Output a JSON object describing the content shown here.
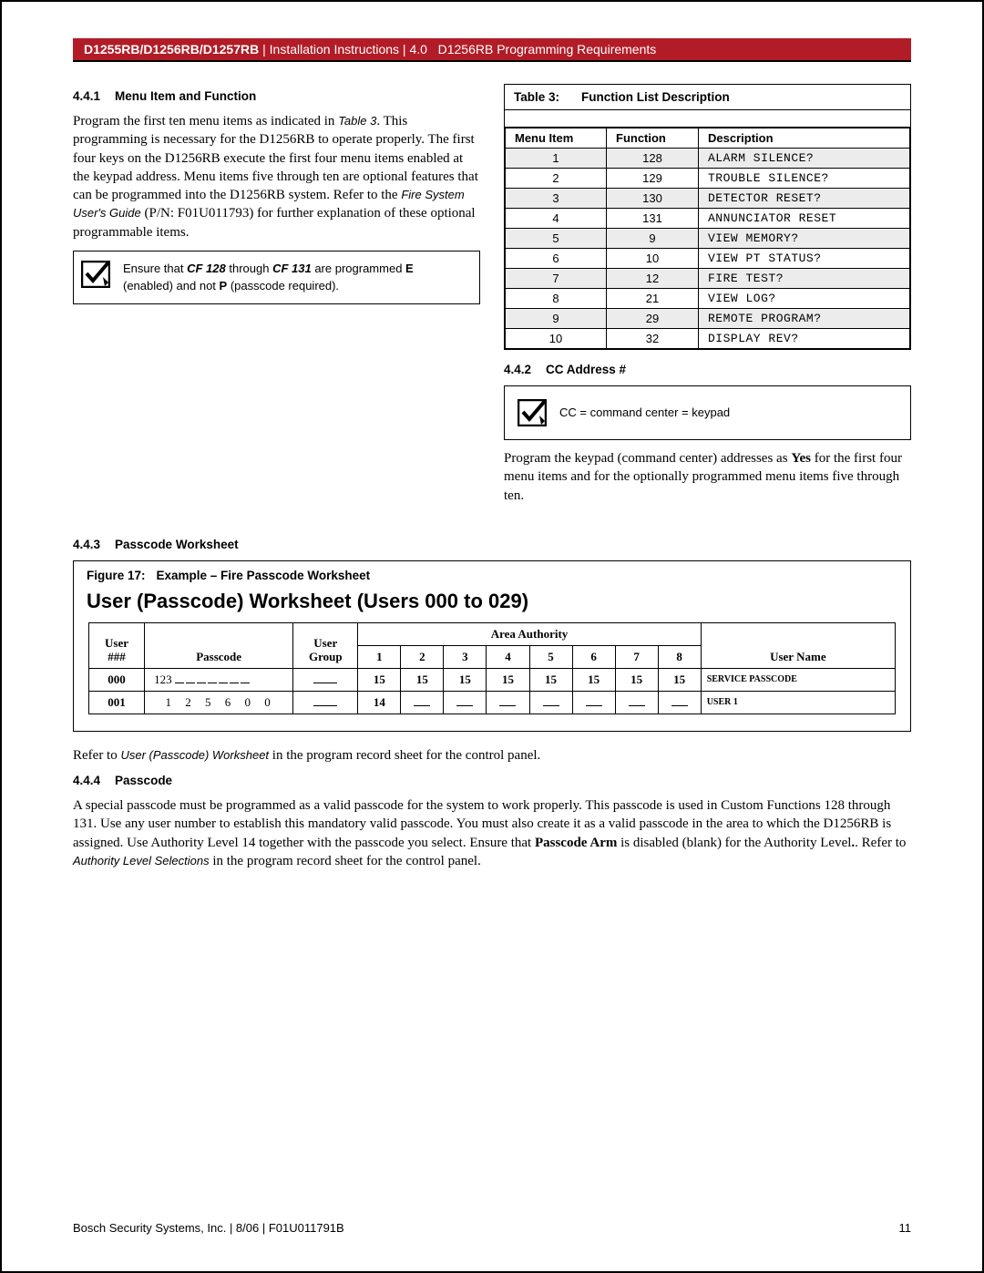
{
  "header": {
    "models": "D1255RB/D1256RB/D1257RB",
    "sep1": " | ",
    "doc_type": "Installation Instructions",
    "sep2": " | ",
    "sec_num": "4.0",
    "sec_title": "D1256RB Programming Requirements"
  },
  "s441": {
    "num": "4.4.1",
    "title": "Menu Item and Function",
    "p_a": "Program the first ten menu items as indicated in ",
    "p_table_ref": "Table 3",
    "p_b": ". This programming is necessary for the D1256RB to operate properly. The first four keys on the D1256RB execute the first four menu items enabled at the keypad address. Menu items five through ten are optional features that can be programmed into the D1256RB system. Refer to the ",
    "p_guide": "Fire System User's Guide",
    "p_c": " (P/N: F01U011793) for further explanation of these optional programmable items.",
    "note_a": "Ensure that ",
    "note_cf128": "CF 128",
    "note_mid": " through ",
    "note_cf131": "CF 131",
    "note_b": " are programmed ",
    "note_e": "E",
    "note_c": " (enabled) and not ",
    "note_p": "P",
    "note_d": " (passcode required)."
  },
  "table3": {
    "label": "Table 3:",
    "title": "Function List Description",
    "h1": "Menu Item",
    "h2": "Function",
    "h3": "Description",
    "rows": [
      {
        "m": "1",
        "f": "128",
        "d": "ALARM SILENCE?"
      },
      {
        "m": "2",
        "f": "129",
        "d": "TROUBLE SILENCE?"
      },
      {
        "m": "3",
        "f": "130",
        "d": "DETECTOR RESET?"
      },
      {
        "m": "4",
        "f": "131",
        "d": "ANNUNCIATOR RESET"
      },
      {
        "m": "5",
        "f": "9",
        "d": "VIEW MEMORY?"
      },
      {
        "m": "6",
        "f": "10",
        "d": "VIEW PT STATUS?"
      },
      {
        "m": "7",
        "f": "12",
        "d": "FIRE TEST?"
      },
      {
        "m": "8",
        "f": "21",
        "d": "VIEW LOG?"
      },
      {
        "m": "9",
        "f": "29",
        "d": "REMOTE PROGRAM?"
      },
      {
        "m": "10",
        "f": "32",
        "d": "DISPLAY REV?"
      }
    ]
  },
  "s442": {
    "num": "4.4.2",
    "title": "CC Address #",
    "note": "CC = command center = keypad",
    "p": "Program the keypad (command center) addresses as ",
    "p_b": "Yes",
    "p2": " for the first four menu items and for the optionally programmed menu items five through ten."
  },
  "s443": {
    "num": "4.4.3",
    "title": "Passcode Worksheet",
    "fig_label": "Figure 17:",
    "fig_title": "Example – Fire Passcode Worksheet",
    "ws_title": "User (Passcode) Worksheet (Users 000 to 029)",
    "h_user": "User ###",
    "h_passcode": "Passcode",
    "h_group": "User Group",
    "h_area": "Area Authority",
    "h_un": "User Name",
    "areas": [
      "1",
      "2",
      "3",
      "4",
      "5",
      "6",
      "7",
      "8"
    ],
    "rows": [
      {
        "u": "000",
        "pc": "123",
        "pc_dashes": 7,
        "g": "",
        "a": [
          "15",
          "15",
          "15",
          "15",
          "15",
          "15",
          "15",
          "15"
        ],
        "un": "SERVICE PASSCODE"
      },
      {
        "u": "001",
        "pc": "1 2 5 6 0 0",
        "pc_dashes": 0,
        "g": "",
        "a": [
          "14",
          "",
          "",
          "",
          "",
          "",
          "",
          ""
        ],
        "un": "USER 1"
      }
    ],
    "after_a": "Refer to ",
    "after_it": "User (Passcode) Worksheet",
    "after_b": " in the program record sheet for the control panel."
  },
  "s444": {
    "num": "4.4.4",
    "title": "Passcode",
    "p_a": "A special passcode must be programmed as a valid passcode for the system to work properly. This passcode is used in Custom Functions 128 through 131. Use any user number to establish this mandatory valid passcode. You must also create it as a valid passcode in the area to which the D1256RB is assigned. Use Authority Level 14 together with the passcode you select. Ensure that ",
    "p_b": "Passcode Arm",
    "p_c": " is disabled (blank) for the Authority Level",
    "p_d": ". Refer to ",
    "p_it": "Authority Level Selections",
    "p_e": " in the program record sheet for the control panel."
  },
  "footer": {
    "left": "Bosch Security Systems, Inc. | 8/06 | F01U011791B",
    "right": "11"
  }
}
